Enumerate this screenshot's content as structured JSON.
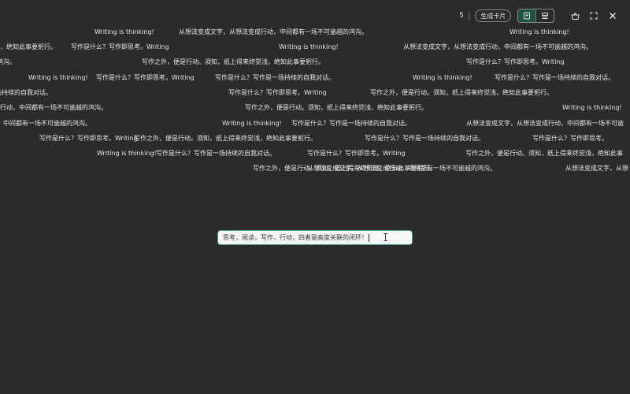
{
  "toolbar": {
    "count": "5",
    "separator": "|",
    "generate_card_label": "生成卡片",
    "icons": [
      "card-view-icon",
      "list-view-icon",
      "basket-icon",
      "fullscreen-icon",
      "close-icon"
    ],
    "accent_color": "#3e8f7a"
  },
  "danmaku": {
    "messages": [
      "Writing is thinking!",
      "从想法变成文字，从想法变成行动，中间都有一场不可逾越的鸿沟。",
      "写作是什么？写作即思考。Writing",
      "写作之外，便是行动。须知，纸上得来终觉浅，绝知此事要躬行。",
      "写作是什么？写作是一场持续的自我对话。"
    ],
    "fragments": {
      "r1_end": "绝知此事要躬行。",
      "r1_start": "浅，绝知此事要躬行。",
      "r2_start": "鸿沟。",
      "r3_start": "场持续的自我对话。",
      "r5_start": "成行动，中间都有一场不可逾越的鸿沟。",
      "r6_start": "，中间都有一场不可逾越的鸿沟。",
      "r6_end": "从想法变成文字，从想法变成行动，中间都有一场不可逾",
      "r8_end": "写作之外，便是行动。须知，纸上得来终觉浅，绝知此事",
      "r9_mid": "从想法变成文字，从想法变成行动，中间都有一场不可逾越的鸿沟。",
      "r9_end": "从想法变成文字，从想",
      "r7_end": "写作是什么？写作即思考。"
    }
  },
  "input": {
    "value": "思考，阅读，写作，行动，四者是高度关联的闭环！"
  }
}
